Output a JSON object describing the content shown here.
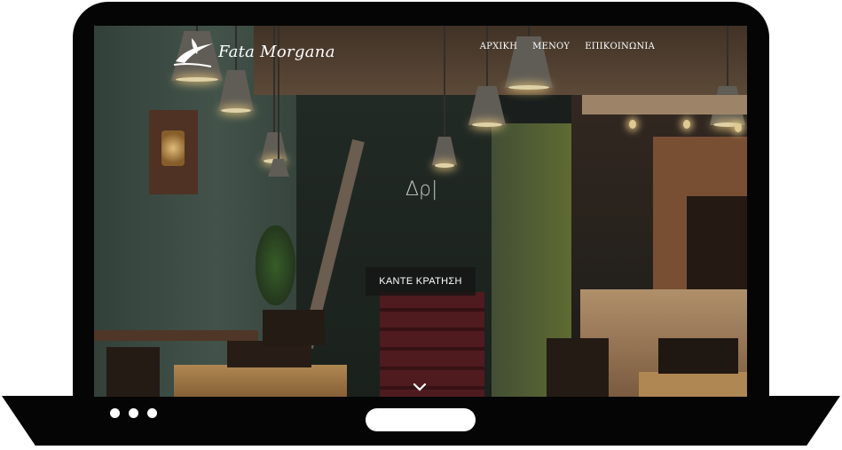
{
  "site": {
    "logo_text": "Fata Morgana",
    "logo_icon": "bird-logo-icon"
  },
  "nav": {
    "items": [
      {
        "label": "ΑΡΧΙΚΗ"
      },
      {
        "label": "ΜΕΝΟΥ"
      },
      {
        "label": "ΕΠΙΚΟΙΝΩΝΙΑ"
      }
    ]
  },
  "hero": {
    "text": "Δρ|",
    "cta_label": "ΚΑΝΤΕ ΚΡΑΤΗΣΗ",
    "scroll_icon": "chevron-down-icon"
  },
  "device": {
    "frame_color": "#050505",
    "indicator_dots": 3
  },
  "colors": {
    "wall_green": "#3d4f46",
    "wood": "#6b4a32",
    "lamp_glow": "#ffe6a8",
    "nav_text": "#ffffff"
  }
}
